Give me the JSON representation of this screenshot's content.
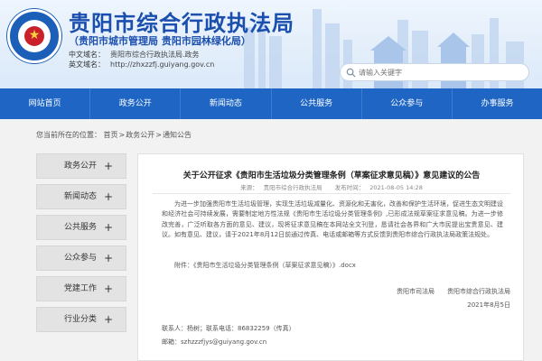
{
  "header": {
    "title": "贵阳市综合行政执法局",
    "subtitle": "（贵阳市城市管理局  贵阳市园林绿化局）",
    "cn_domain_label": "中文域名：",
    "cn_domain": "贵阳市综合行政执法局.政务",
    "en_domain_label": "英文域名：",
    "en_domain": "http://zhxzzfj.guiyang.gov.cn",
    "search_placeholder": "请输入关键字"
  },
  "nav": {
    "items": [
      "网站首页",
      "政务公开",
      "新闻动态",
      "公共服务",
      "公众参与",
      "办事服务"
    ]
  },
  "breadcrumb": {
    "prefix": "您当前所在的位置：",
    "items": [
      "首页",
      "政务公开",
      "通知公告"
    ],
    "separator": ">"
  },
  "sidebar": {
    "items": [
      "政务公开",
      "新闻动态",
      "公共服务",
      "公众参与",
      "党建工作",
      "行业分类"
    ],
    "expand_symbol": "+"
  },
  "article": {
    "title": "关于公开征求《贵阳市生活垃圾分类管理条例（草案征求意见稿）》意见建议的公告",
    "source_label": "来源：",
    "source": "贵阳市综合行政执法局",
    "date_label": "发布时间：",
    "date": "2021-08-05 14:28",
    "body": "为进一步加强贵阳市生活垃圾管理，实现生活垃圾减量化、资源化和无害化，改善和保护生活环境，促进生态文明建设和经济社会可持续发展，需要制定地方性法规《贵阳市生活垃圾分类管理条例》,已形成法规草案征求意见稿。为进一步修改完善，广泛听取各方面的意见、建议，现将征求意见稿在本网站全文刊登，恳请社会各界和广大市民提出宝贵意见、建议。如有意见、建议，请于2021年8月12日前通过传真、电话或邮箱等方式反馈到贵阳市综合行政执法局政策法规处。",
    "attachment": "附件：《贵阳市生活垃圾分类管理条例（草案征求意见稿）》.docx",
    "signers": [
      "贵阳市司法局",
      "贵阳市综合行政执法局"
    ],
    "sign_date": "2021年8月5日",
    "contact_line1": "联系人：杨树；联系电话：86832259（传真）",
    "contact_line2": "邮箱：szhzzzfjys@guiyang.gov.cn"
  },
  "colors": {
    "nav_bg": "#1f66c4",
    "title_blue": "#1b4fae",
    "sidebar_bg": "#e3e3e3"
  }
}
